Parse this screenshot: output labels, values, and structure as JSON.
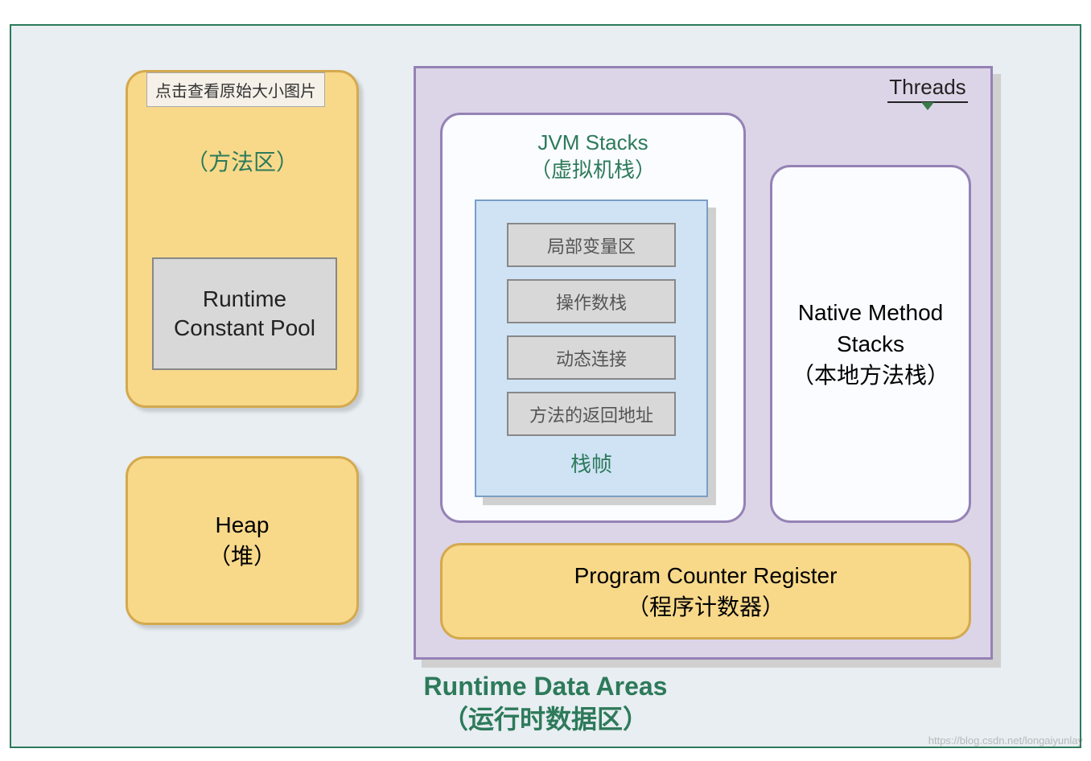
{
  "tooltip": "点击查看原始大小图片",
  "methodArea": {
    "subtitle_cn": "（方法区）",
    "constantPool": "Runtime\nConstant Pool"
  },
  "heap": {
    "title_en": "Heap",
    "subtitle_cn": "（堆）"
  },
  "threads": {
    "label": "Threads"
  },
  "jvmStacks": {
    "title_en": "JVM Stacks",
    "subtitle_cn": "（虚拟机栈）",
    "frame": {
      "items": [
        "局部变量区",
        "操作数栈",
        "动态连接",
        "方法的返回地址"
      ],
      "label": "栈帧"
    }
  },
  "nativeStacks": {
    "title_en": "Native Method Stacks",
    "subtitle_cn": "（本地方法栈）"
  },
  "pcRegister": {
    "title_en": "Program Counter Register",
    "subtitle_cn": "（程序计数器）"
  },
  "bottomTitle": {
    "title_en": "Runtime Data Areas",
    "subtitle_cn": "（运行时数据区）"
  },
  "watermark": "https://blog.csdn.net/longaiyunlay"
}
